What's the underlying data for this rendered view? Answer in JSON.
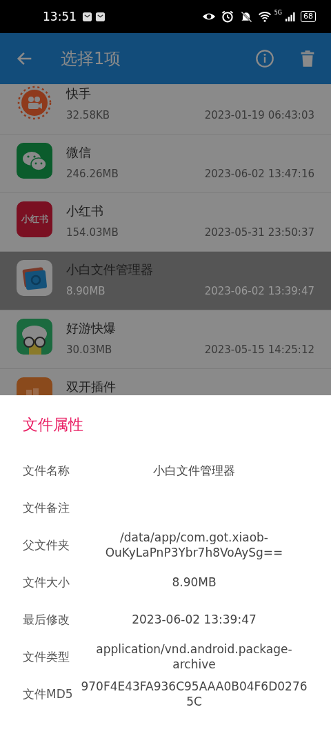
{
  "status_bar": {
    "time": "13:51",
    "network": "5G",
    "battery": "68"
  },
  "app_bar": {
    "title": "选择1项"
  },
  "files": [
    {
      "name": "快手",
      "size": "32.58KB",
      "date": "2023-01-19 06:43:03",
      "selected": false,
      "kind": "kuaishou"
    },
    {
      "name": "微信",
      "size": "246.26MB",
      "date": "2023-06-02 13:47:16",
      "selected": false,
      "kind": "wechat"
    },
    {
      "name": "小红书",
      "size": "154.03MB",
      "date": "2023-05-31 23:50:37",
      "selected": false,
      "kind": "xiaohongshu",
      "logo_text": "小红书"
    },
    {
      "name": "小白文件管理器",
      "size": "8.90MB",
      "date": "2023-06-02 13:39:47",
      "selected": true,
      "kind": "filemanager"
    },
    {
      "name": "好游快爆",
      "size": "30.03MB",
      "date": "2023-05-15 14:25:12",
      "selected": false,
      "kind": "haoyou"
    },
    {
      "name": "双开插件",
      "selected": false,
      "kind": "dual"
    }
  ],
  "dialog": {
    "title": "文件属性",
    "fields": [
      {
        "label": "文件名称",
        "value": "小白文件管理器"
      },
      {
        "label": "文件备注"
      },
      {
        "label": "父文件夹",
        "value": "/data/app/com.got.xiaob-OuKyLaPnP3Ybr7h8VoAySg=="
      },
      {
        "label": "文件大小",
        "value": "8.90MB"
      },
      {
        "label": "最后修改",
        "value": "2023-06-02 13:39:47"
      },
      {
        "label": "文件类型",
        "value": "application/vnd.android.package-archive"
      },
      {
        "label": "文件MD5",
        "value": "970F4E43FA936C95AAA0B04F6D02765C"
      }
    ]
  }
}
